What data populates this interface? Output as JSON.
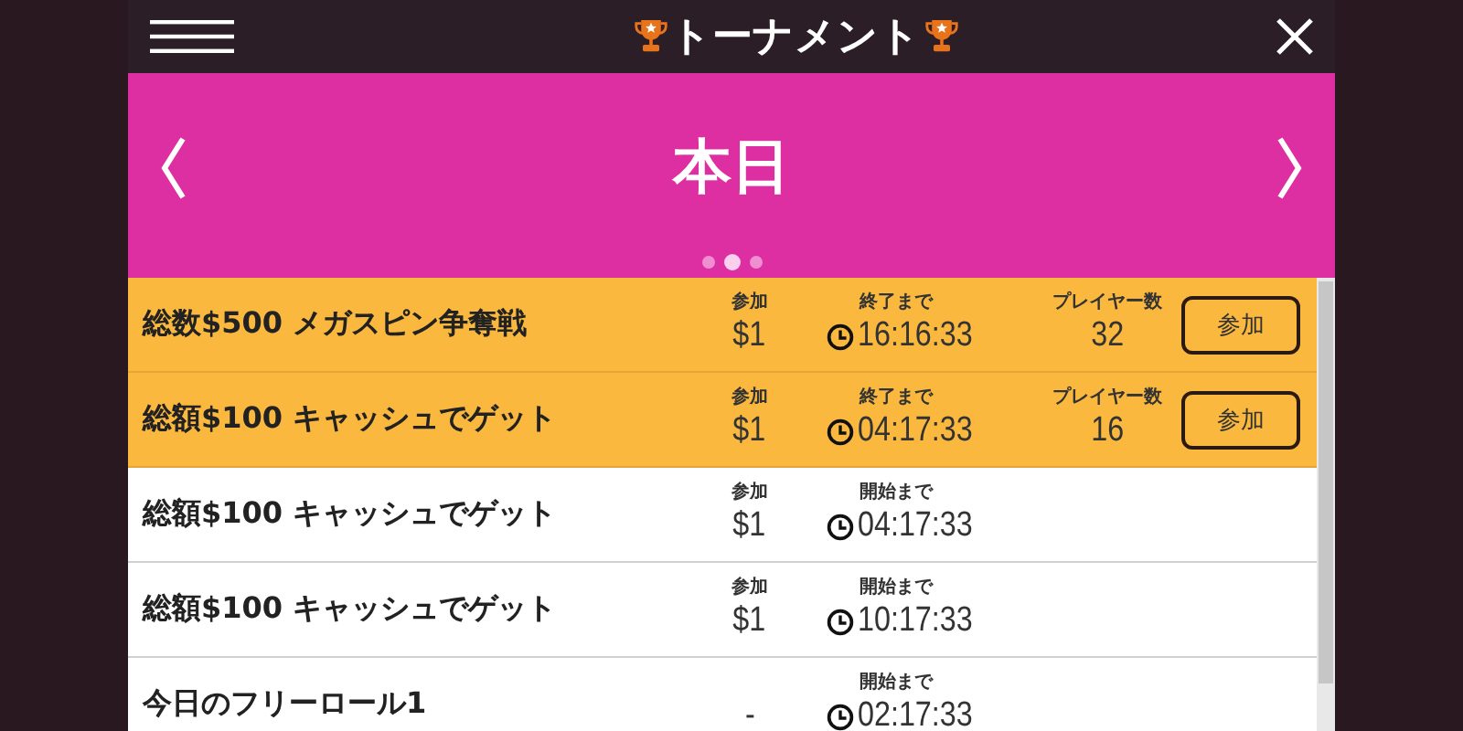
{
  "header": {
    "title": "トーナメント"
  },
  "banner": {
    "title": "本日",
    "dots": [
      {
        "selected": false
      },
      {
        "selected": true
      },
      {
        "selected": false
      }
    ]
  },
  "rows": [
    {
      "name": "総数$500 メガスピン争奪戦",
      "highlighted": true,
      "entry_label": "参加",
      "entry": "$1",
      "timer_label": "終了まで",
      "time": "16:16:33",
      "players_label": "プレイヤー数",
      "players": "32",
      "button": "参加"
    },
    {
      "name": "総額$100 キャッシュでゲット",
      "highlighted": true,
      "entry_label": "参加",
      "entry": "$1",
      "timer_label": "終了まで",
      "time": "04:17:33",
      "players_label": "プレイヤー数",
      "players": "16",
      "button": "参加"
    },
    {
      "name": "総額$100 キャッシュでゲット",
      "highlighted": false,
      "entry_label": "参加",
      "entry": "$1",
      "timer_label": "開始まで",
      "time": "04:17:33"
    },
    {
      "name": "総額$100 キャッシュでゲット",
      "highlighted": false,
      "entry_label": "参加",
      "entry": "$1",
      "timer_label": "開始まで",
      "time": "10:17:33"
    },
    {
      "name": "今日のフリーロール1",
      "highlighted": false,
      "entry": "-",
      "timer_label": "開始まで",
      "time": "02:17:33"
    }
  ]
}
